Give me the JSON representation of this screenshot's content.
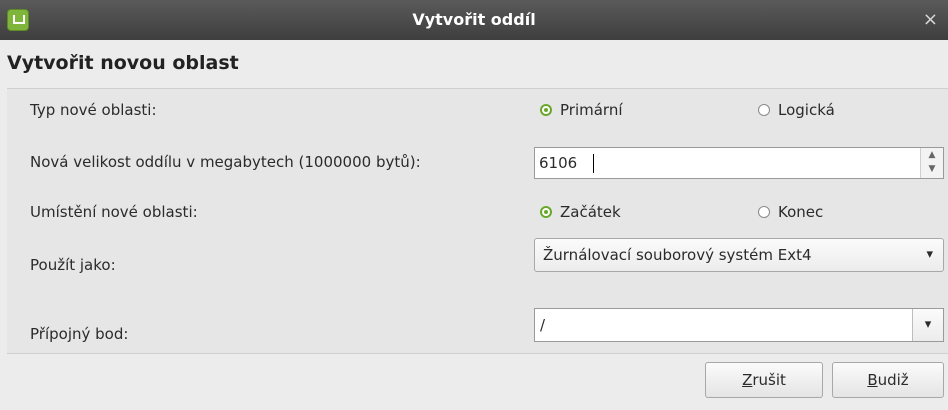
{
  "window": {
    "title": "Vytvořit oddíl",
    "close_glyph": "×"
  },
  "heading": "Vytvořit novou oblast",
  "type_row": {
    "label": "Typ nové oblasti:",
    "options": [
      {
        "label": "Primární",
        "checked": true
      },
      {
        "label": "Logická",
        "checked": false
      }
    ]
  },
  "size_row": {
    "label": "Nová velikost oddílu v megabytech (1000000 bytů):",
    "value": "6106"
  },
  "location_row": {
    "label": "Umístění nové oblasti:",
    "options": [
      {
        "label": "Začátek",
        "checked": true
      },
      {
        "label": "Konec",
        "checked": false
      }
    ]
  },
  "use_as_row": {
    "label": "Použít jako:",
    "selected": "Žurnálovací souborový systém Ext4"
  },
  "mount_row": {
    "label": "Přípojný bod:",
    "value": "/"
  },
  "buttons": {
    "cancel": {
      "mnemonic": "Z",
      "rest": "rušit"
    },
    "ok": {
      "mnemonic": "B",
      "rest": "udiž"
    }
  },
  "colors": {
    "accent": "#6aa82a",
    "titlebar": "#4a4a4a",
    "background": "#ececec"
  },
  "icons": [
    "linux-mint-icon",
    "close-icon",
    "chevron-down-icon",
    "spin-arrows-icon"
  ]
}
